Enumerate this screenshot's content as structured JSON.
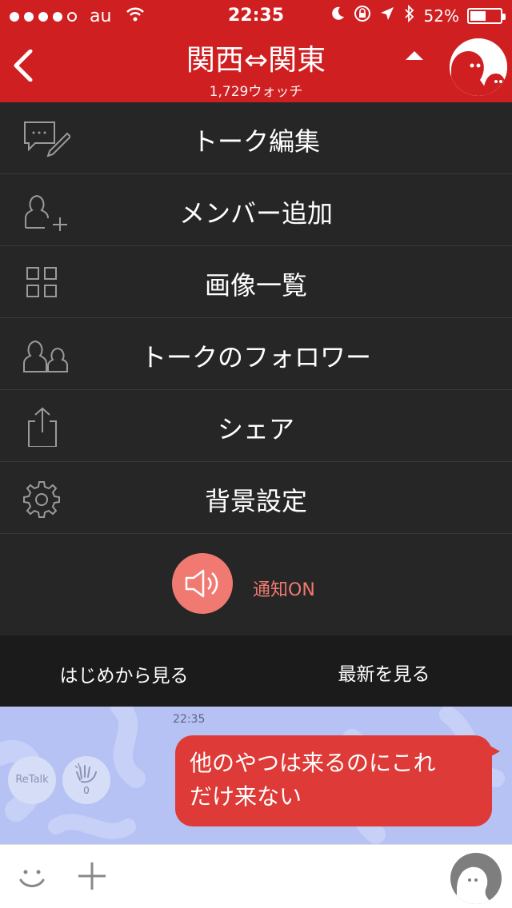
{
  "status_bar": {
    "carrier": "au",
    "time": "22:35",
    "battery_percent_text": "52%",
    "battery_level": 0.52
  },
  "header": {
    "title": "関西⇔関東",
    "subtitle": "1,729ウォッチ",
    "bg_color": "#d01f21"
  },
  "menu": {
    "items": [
      {
        "label": "トーク編集",
        "icon": "edit-talk-icon"
      },
      {
        "label": "メンバー追加",
        "icon": "add-member-icon"
      },
      {
        "label": "画像一覧",
        "icon": "image-grid-icon"
      },
      {
        "label": "トークのフォロワー",
        "icon": "followers-icon"
      },
      {
        "label": "シェア",
        "icon": "share-icon"
      },
      {
        "label": "背景設定",
        "icon": "gear-icon"
      }
    ],
    "notify_label": "通知ON",
    "notify_color": "#f07a72"
  },
  "view_bar": {
    "from_start_label": "はじめから見る",
    "latest_label": "最新を見る"
  },
  "chat": {
    "time": "22:35",
    "retalk_label": "ReTalk",
    "clap_count": "0",
    "message_line1": "他のやつは来るのにこれ",
    "message_line2": "だけ来ない",
    "bubble_color": "#de3a37"
  }
}
